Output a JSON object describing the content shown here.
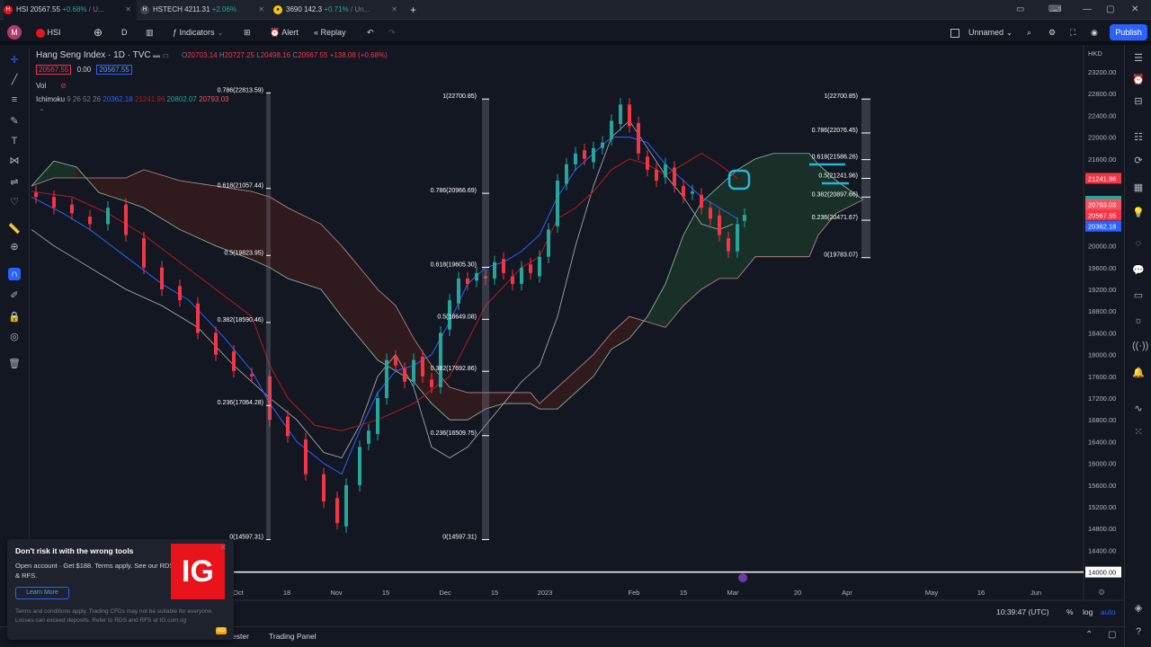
{
  "tabs": [
    {
      "icon": "H",
      "label": "HSI",
      "price": "20567.55",
      "change": "+0.68%",
      "suffix": "/ U..."
    },
    {
      "icon": "H",
      "label": "HSTECH",
      "price": "4211.31",
      "change": "+2.06%",
      "suffix": ""
    },
    {
      "icon": "●",
      "label": "3690",
      "price": "142.3",
      "change": "+0.71%",
      "suffix": "/ Un..."
    }
  ],
  "toolbar": {
    "symbol": "HSI",
    "interval": "D",
    "indicators": "Indicators",
    "alert": "Alert",
    "replay": "Replay",
    "layout": "Unnamed",
    "publish": "Publish",
    "avatar": "M"
  },
  "legend": {
    "title": "Hang Seng Index · 1D · TVC",
    "ohlc": {
      "o_label": "O",
      "o": "20703.14",
      "h_label": "H",
      "h": "20727.25",
      "l_label": "L",
      "l": "20498.16",
      "c_label": "C",
      "c": "20567.55",
      "chg": "+138.08 (+0.68%)"
    },
    "bid": "20567.55",
    "spread": "0.00",
    "ask": "20567.55",
    "vol": "Vol",
    "ichimoku": {
      "name": "Ichimoku",
      "params": "9 26 52 26",
      "v1": "20362.18",
      "v2": "21241.96",
      "v3": "20802.07",
      "v4": "20793.03"
    }
  },
  "price_axis": {
    "currency": "HKD",
    "ticks": [
      "23200.00",
      "22800.00",
      "22400.00",
      "22000.00",
      "21600.00",
      "21200.00",
      "20800.00",
      "20400.00",
      "20000.00",
      "19600.00",
      "19200.00",
      "18800.00",
      "18400.00",
      "18000.00",
      "17600.00",
      "17200.00",
      "16800.00",
      "16400.00",
      "16000.00",
      "15600.00",
      "15200.00",
      "14800.00",
      "14400.00",
      "14000.00"
    ],
    "tags": [
      {
        "value": "21241.96",
        "color": "#f23645"
      },
      {
        "value": "20802.07",
        "color": "#26a69a"
      },
      {
        "value": "20793.03",
        "color": "#f7525f"
      },
      {
        "value": "20567.55",
        "color": "#f23645"
      },
      {
        "value": "20362.18",
        "color": "#2962ff"
      }
    ]
  },
  "time_axis": [
    "Oct",
    "18",
    "Nov",
    "15",
    "Dec",
    "15",
    "2023",
    "Feb",
    "15",
    "Mar",
    "20",
    "Apr",
    "May",
    "16",
    "Jun"
  ],
  "fib_left": [
    {
      "label": "0.786(22813.59)"
    },
    {
      "label": "0.618(21057.44)"
    },
    {
      "label": "0.5(19823.95)"
    },
    {
      "label": "0.382(18590.46)"
    },
    {
      "label": "0.236(17064.28)"
    },
    {
      "label": "0(14597.31)"
    }
  ],
  "fib_mid": [
    {
      "label": "1(22700.85)"
    },
    {
      "label": "0.786(20966.69)"
    },
    {
      "label": "0.618(19605.30)"
    },
    {
      "label": "0.5(18649.08)"
    },
    {
      "label": "0.382(17692.86)"
    },
    {
      "label": "0.236(16509.75)"
    },
    {
      "label": "0(14597.31)"
    }
  ],
  "fib_right": [
    {
      "label": "1(22700.85)"
    },
    {
      "label": "0.786(22076.45)"
    },
    {
      "label": "0.618(21586.26)"
    },
    {
      "label": "0.5(21241.96)"
    },
    {
      "label": "0.382(20897.66)"
    },
    {
      "label": "0.236(20471.67)"
    },
    {
      "label": "0(19783.07)"
    }
  ],
  "hline": "14000.00",
  "status": {
    "time": "10:39:47 (UTC)",
    "percent": "%",
    "log": "log",
    "auto": "auto"
  },
  "bottom_tabs": [
    "ester",
    "Trading Panel"
  ],
  "ad": {
    "heading": "Don't risk it with the wrong tools",
    "body": "Open account · Get $188. Terms apply. See our RDS & RFS.",
    "button": "Learn More",
    "fine": "Terms and conditions apply. Trading CFDs may not be suitable for everyone. Losses can exceed deposits. Refer to RDS and RFS at IG.com.sg",
    "logo": "IG",
    "tag": "AD"
  },
  "colors": {
    "bg": "#131722",
    "up": "#26a69a",
    "down": "#f23645",
    "tenkan": "#2962ff",
    "kijun": "#b71c1c",
    "lead": "#d1d4dc",
    "cloud_up": "#1b3a2b",
    "cloud_down": "#3a1c1c",
    "accent": "#2962ff",
    "highlight": "#29b6d6"
  }
}
